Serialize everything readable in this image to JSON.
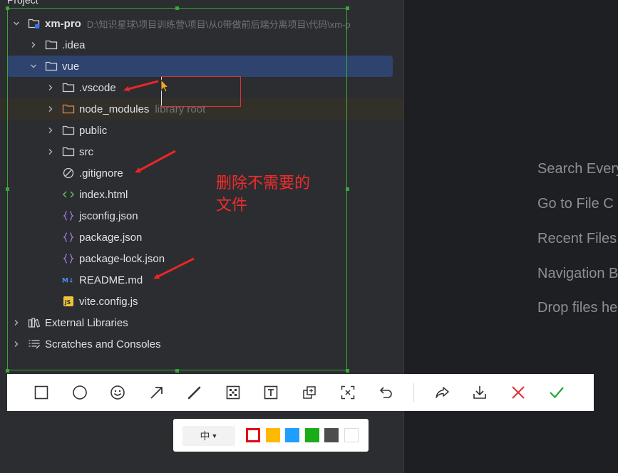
{
  "header": {
    "title": "Project"
  },
  "tree": [
    {
      "name": "xm-pro",
      "path": "D:\\知识星球\\项目训练营\\项目\\从0带做前后端分离项目\\代码\\xm-p",
      "icon": "module-folder-icon",
      "chevron": "down",
      "bold": true
    },
    {
      "name": ".idea",
      "icon": "folder-icon",
      "chevron": "right"
    },
    {
      "name": "vue",
      "icon": "folder-icon",
      "chevron": "down",
      "selected": true
    },
    {
      "name": ".vscode",
      "icon": "folder-icon",
      "chevron": "right"
    },
    {
      "name": "node_modules",
      "suffix": "library root",
      "icon": "orange-folder-icon",
      "chevron": "right"
    },
    {
      "name": "public",
      "icon": "folder-icon",
      "chevron": "right"
    },
    {
      "name": "src",
      "icon": "folder-icon",
      "chevron": "right"
    },
    {
      "name": ".gitignore",
      "icon": "ignore-file-icon"
    },
    {
      "name": "index.html",
      "icon": "html-file-icon"
    },
    {
      "name": "jsconfig.json",
      "icon": "json-file-icon"
    },
    {
      "name": "package.json",
      "icon": "json-file-icon"
    },
    {
      "name": "package-lock.json",
      "icon": "json-file-icon"
    },
    {
      "name": "README.md",
      "icon": "markdown-file-icon"
    },
    {
      "name": "vite.config.js",
      "icon": "js-file-icon"
    },
    {
      "name": "External Libraries",
      "icon": "library-icon",
      "chevron": "right"
    },
    {
      "name": "Scratches and Consoles",
      "icon": "scratches-icon",
      "chevron": "right"
    }
  ],
  "right_hints": [
    "Search Every",
    "Go to File  C",
    "Recent Files",
    "Navigation B",
    "Drop files he"
  ],
  "annotation": {
    "line1": "删除不需要的",
    "line2": "文件",
    "color": "#f22c2c"
  },
  "toolbar": {
    "tools": [
      "rectangle-tool",
      "ellipse-tool",
      "emoji-tool",
      "arrow-tool",
      "pen-tool",
      "mosaic-tool",
      "text-tool",
      "pin-tool",
      "ocr-tool",
      "undo-tool",
      "share-tool",
      "download-tool",
      "cancel-tool",
      "confirm-tool"
    ]
  },
  "subbar": {
    "size": "中",
    "colors": [
      "#e60012",
      "#ffb900",
      "#1e9fff",
      "#1aad19",
      "#4d4d4d",
      "#ffffff"
    ],
    "selected_color": "#e60012"
  }
}
